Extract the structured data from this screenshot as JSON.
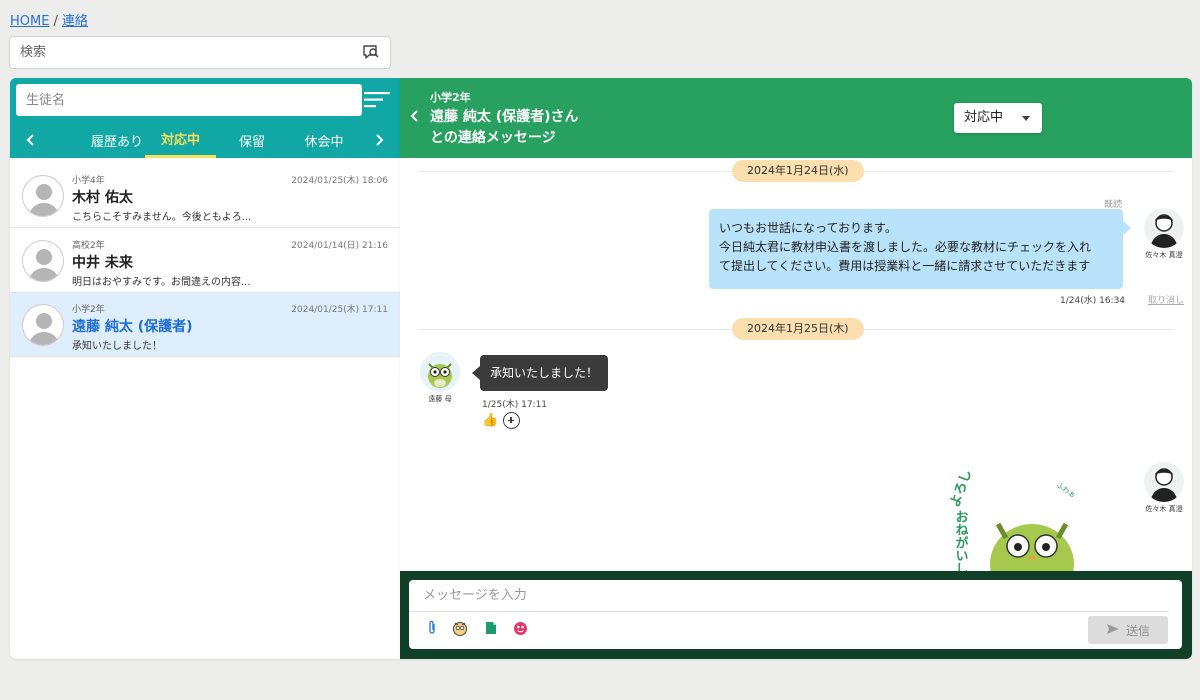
{
  "breadcrumb": {
    "home": "HOME",
    "separator": "/",
    "current": "連絡"
  },
  "global_search": {
    "placeholder": "検索",
    "icon": "chat-search-icon"
  },
  "student_list": {
    "search_placeholder": "生徒名",
    "filter_icon": "filter-sort-icon",
    "tabs": [
      {
        "label": "履歴あり",
        "active": false
      },
      {
        "label": "対応中",
        "active": true
      },
      {
        "label": "保留",
        "active": false
      },
      {
        "label": "休会中",
        "active": false
      }
    ],
    "contacts": [
      {
        "grade": "小学4年",
        "time": "2024/01/25(木) 18:06",
        "name": "木村 佑太",
        "preview": "こちらこそすみません。今後ともよろ...",
        "selected": false
      },
      {
        "grade": "高校2年",
        "time": "2024/01/14(日) 21:16",
        "name": "中井 未来",
        "preview": "明日はおやすみです。お間違えの内容...",
        "selected": false
      },
      {
        "grade": "小学2年",
        "time": "2024/01/25(木) 17:11",
        "name": "遠藤 純太 (保護者)",
        "preview": "承知いたしました！",
        "selected": true
      }
    ]
  },
  "chat": {
    "grade": "小学2年",
    "title_line1": "遠藤 純太 (保護者)さん",
    "title_line2": "との連絡メッセージ",
    "status": "対応中",
    "dates": [
      "2024年1月24日(水)",
      "2024年1月25日(木)"
    ],
    "outgoing": {
      "read_label": "既読",
      "lines": [
        "いつもお世話になっております。",
        "今日純太君に教材申込書を渡しました。必要な教材にチェックを入れ",
        "て提出してください。費用は授業料と一緒に請求させていただきます"
      ],
      "time": "1/24(水) 16:34",
      "cancel_label": "取り消し",
      "sender": "佐々木 真澄"
    },
    "incoming": {
      "text": "承知いたしました！",
      "sender": "遠藤 母",
      "time": "1/25(木) 17:11",
      "reaction": "👍"
    },
    "sticker": {
      "sender": "佐々木 真澄",
      "text_line1": "よろしく",
      "text_line2": "おねがいしま",
      "sound": "ふわぁ"
    },
    "composer": {
      "placeholder": "メッセージを入力",
      "send_label": "送信",
      "tools": [
        "paperclip-icon",
        "stamp-icon",
        "file-icon",
        "sticker-icon"
      ]
    }
  },
  "colors": {
    "teal": "#11a7a4",
    "green": "#28a05f",
    "dark_green": "#0f3f27",
    "date_pill": "#fbdfae",
    "bubble_out": "#b8e3fa",
    "bubble_in": "#3b3b3b",
    "active_tab": "#f6e25a"
  }
}
